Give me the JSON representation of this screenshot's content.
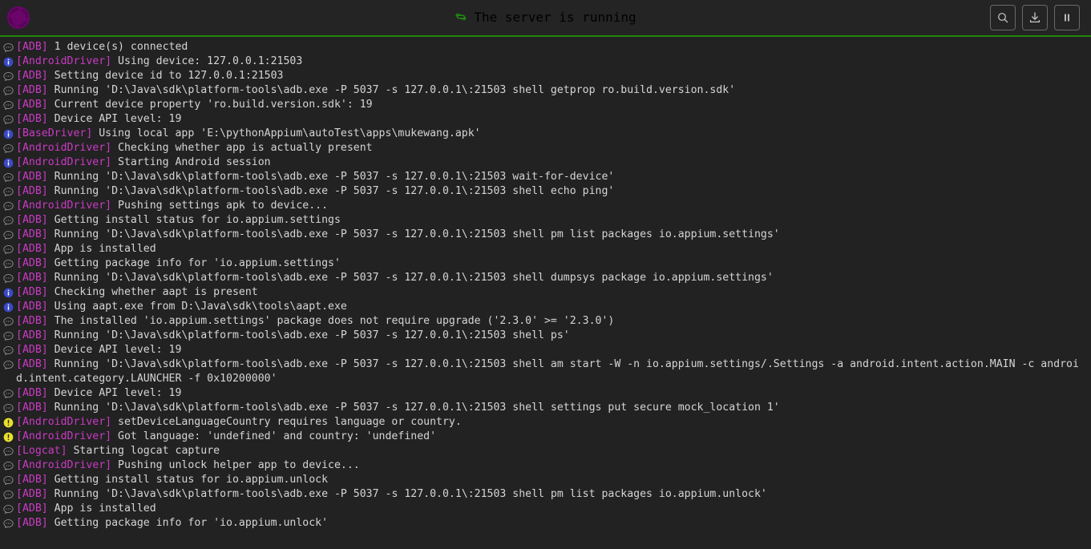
{
  "header": {
    "logo_name": "appium-logo",
    "status_icon": "sync-icon",
    "status_text": "The server is running",
    "status_color": "#1f8c12",
    "actions": [
      {
        "name": "search-button",
        "icon": "search-icon",
        "label": "Search"
      },
      {
        "name": "download-logs-button",
        "icon": "download-icon",
        "label": "Download Logs"
      },
      {
        "name": "pause-logs-button",
        "icon": "pause-icon",
        "label": "Pause"
      }
    ]
  },
  "theme": {
    "background": "#222222",
    "header_background": "#242424",
    "accent_green": "#22860a",
    "tag_color": "#c93bc4",
    "text_color": "#d5d5d5",
    "info_color": "#3b49c4",
    "warn_color": "#e8e02e",
    "debug_color": "#8f8f8f"
  },
  "log": {
    "lines": [
      {
        "level": "debug",
        "tag": "[ADB]",
        "message": "1 device(s) connected"
      },
      {
        "level": "info",
        "tag": "[AndroidDriver]",
        "message": "Using device: 127.0.0.1:21503"
      },
      {
        "level": "debug",
        "tag": "[ADB]",
        "message": "Setting device id to 127.0.0.1:21503"
      },
      {
        "level": "debug",
        "tag": "[ADB]",
        "message": "Running 'D:\\Java\\sdk\\platform-tools\\adb.exe -P 5037 -s 127.0.0.1\\:21503 shell getprop ro.build.version.sdk'"
      },
      {
        "level": "debug",
        "tag": "[ADB]",
        "message": "Current device property 'ro.build.version.sdk': 19"
      },
      {
        "level": "debug",
        "tag": "[ADB]",
        "message": "Device API level: 19"
      },
      {
        "level": "info",
        "tag": "[BaseDriver]",
        "message": "Using local app 'E:\\pythonAppium\\autoTest\\apps\\mukewang.apk'"
      },
      {
        "level": "debug",
        "tag": "[AndroidDriver]",
        "message": "Checking whether app is actually present"
      },
      {
        "level": "info",
        "tag": "[AndroidDriver]",
        "message": "Starting Android session"
      },
      {
        "level": "debug",
        "tag": "[ADB]",
        "message": "Running 'D:\\Java\\sdk\\platform-tools\\adb.exe -P 5037 -s 127.0.0.1\\:21503 wait-for-device'"
      },
      {
        "level": "debug",
        "tag": "[ADB]",
        "message": "Running 'D:\\Java\\sdk\\platform-tools\\adb.exe -P 5037 -s 127.0.0.1\\:21503 shell echo ping'"
      },
      {
        "level": "debug",
        "tag": "[AndroidDriver]",
        "message": "Pushing settings apk to device..."
      },
      {
        "level": "debug",
        "tag": "[ADB]",
        "message": "Getting install status for io.appium.settings"
      },
      {
        "level": "debug",
        "tag": "[ADB]",
        "message": "Running 'D:\\Java\\sdk\\platform-tools\\adb.exe -P 5037 -s 127.0.0.1\\:21503 shell pm list packages io.appium.settings'"
      },
      {
        "level": "debug",
        "tag": "[ADB]",
        "message": "App is installed"
      },
      {
        "level": "debug",
        "tag": "[ADB]",
        "message": "Getting package info for 'io.appium.settings'"
      },
      {
        "level": "debug",
        "tag": "[ADB]",
        "message": "Running 'D:\\Java\\sdk\\platform-tools\\adb.exe -P 5037 -s 127.0.0.1\\:21503 shell dumpsys package io.appium.settings'"
      },
      {
        "level": "info",
        "tag": "[ADB]",
        "message": "Checking whether aapt is present"
      },
      {
        "level": "info",
        "tag": "[ADB]",
        "message": "Using aapt.exe from D:\\Java\\sdk\\tools\\aapt.exe"
      },
      {
        "level": "debug",
        "tag": "[ADB]",
        "message": "The installed 'io.appium.settings' package does not require upgrade ('2.3.0' >= '2.3.0')"
      },
      {
        "level": "debug",
        "tag": "[ADB]",
        "message": "Running 'D:\\Java\\sdk\\platform-tools\\adb.exe -P 5037 -s 127.0.0.1\\:21503 shell ps'"
      },
      {
        "level": "debug",
        "tag": "[ADB]",
        "message": "Device API level: 19"
      },
      {
        "level": "debug",
        "tag": "[ADB]",
        "message": "Running 'D:\\Java\\sdk\\platform-tools\\adb.exe -P 5037 -s 127.0.0.1\\:21503 shell am start -W -n io.appium.settings/.Settings -a android.intent.action.MAIN -c android.intent.category.LAUNCHER -f 0x10200000'"
      },
      {
        "level": "debug",
        "tag": "[ADB]",
        "message": "Device API level: 19"
      },
      {
        "level": "debug",
        "tag": "[ADB]",
        "message": "Running 'D:\\Java\\sdk\\platform-tools\\adb.exe -P 5037 -s 127.0.0.1\\:21503 shell settings put secure mock_location 1'"
      },
      {
        "level": "warn",
        "tag": "[AndroidDriver]",
        "message": "setDeviceLanguageCountry requires language or country."
      },
      {
        "level": "warn",
        "tag": "[AndroidDriver]",
        "message": "Got language: 'undefined' and country: 'undefined'"
      },
      {
        "level": "debug",
        "tag": "[Logcat]",
        "message": "Starting logcat capture"
      },
      {
        "level": "debug",
        "tag": "[AndroidDriver]",
        "message": "Pushing unlock helper app to device..."
      },
      {
        "level": "debug",
        "tag": "[ADB]",
        "message": "Getting install status for io.appium.unlock"
      },
      {
        "level": "debug",
        "tag": "[ADB]",
        "message": "Running 'D:\\Java\\sdk\\platform-tools\\adb.exe -P 5037 -s 127.0.0.1\\:21503 shell pm list packages io.appium.unlock'"
      },
      {
        "level": "debug",
        "tag": "[ADB]",
        "message": "App is installed"
      },
      {
        "level": "debug",
        "tag": "[ADB]",
        "message": "Getting package info for 'io.appium.unlock'"
      }
    ]
  }
}
